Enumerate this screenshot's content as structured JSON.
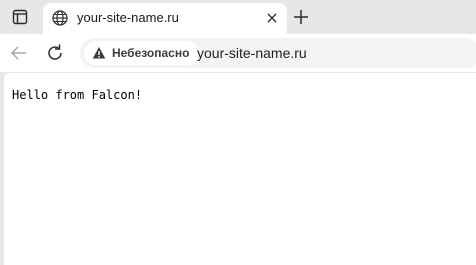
{
  "tab": {
    "title": "your-site-name.ru",
    "icon": "globe-icon"
  },
  "toolbar": {
    "security_label": "Небезопасно",
    "url": "your-site-name.ru"
  },
  "page": {
    "body_text": "Hello from Falcon!"
  },
  "colors": {
    "tabstrip": "#e7e7e7",
    "toolbar": "#ffffff",
    "omnibox": "#f3f3f3",
    "warning_icon": "#3c3c3c"
  }
}
